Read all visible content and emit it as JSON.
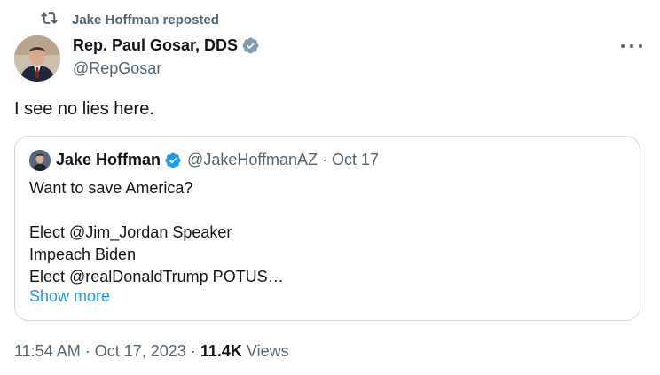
{
  "repost": {
    "label": "Jake Hoffman reposted",
    "icon": "repost-icon"
  },
  "author": {
    "name": "Rep. Paul Gosar, DDS",
    "handle": "@RepGosar",
    "verified_icon": "verified-badge-icon",
    "verified_color": "#829aab"
  },
  "tweet": {
    "text": "I see no lies here."
  },
  "quote": {
    "name": "Jake Hoffman",
    "handle": "@JakeHoffmanAZ",
    "separator": "·",
    "date": "Oct 17",
    "verified_icon": "verified-badge-icon",
    "verified_color": "#1d9bf0",
    "lines": [
      "Want to save America?",
      "",
      "Elect @Jim_Jordan Speaker",
      "Impeach Biden",
      "Elect @realDonaldTrump POTUS…"
    ],
    "show_more": "Show more"
  },
  "meta": {
    "time": "11:54 AM",
    "separator": "·",
    "date": "Oct 17, 2023",
    "views_count": "11.4K",
    "views_label": "Views"
  },
  "colors": {
    "text": "#0f1419",
    "secondary": "#536471",
    "link": "#1d9bf0",
    "border": "#cfd9de"
  }
}
